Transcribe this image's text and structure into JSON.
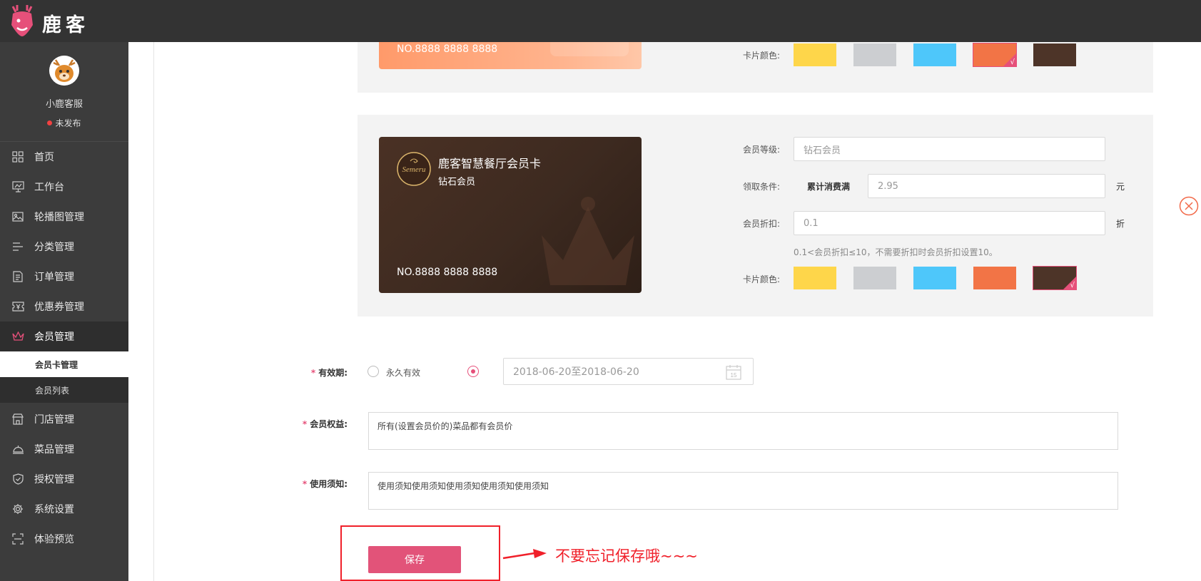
{
  "header": {
    "brand": "鹿客"
  },
  "profile": {
    "name": "小鹿客服",
    "status": "未发布"
  },
  "nav": {
    "items": [
      {
        "label": "首页",
        "icon": "grid-icon"
      },
      {
        "label": "工作台",
        "icon": "monitor-icon"
      },
      {
        "label": "轮播图管理",
        "icon": "image-icon"
      },
      {
        "label": "分类管理",
        "icon": "list-icon"
      },
      {
        "label": "订单管理",
        "icon": "document-icon"
      },
      {
        "label": "优惠券管理",
        "icon": "coupon-icon"
      },
      {
        "label": "会员管理",
        "icon": "crown-icon"
      },
      {
        "label": "门店管理",
        "icon": "store-icon"
      },
      {
        "label": "菜品管理",
        "icon": "cloche-icon"
      },
      {
        "label": "授权管理",
        "icon": "shield-icon"
      },
      {
        "label": "系统设置",
        "icon": "gear-icon"
      },
      {
        "label": "体验预览",
        "icon": "scan-icon"
      }
    ],
    "sub_items": [
      {
        "label": "会员卡管理"
      },
      {
        "label": "会员列表"
      }
    ],
    "active": "会员管理",
    "active_sub": "会员卡管理"
  },
  "card_top": {
    "number": "NO.8888 8888 8888",
    "color_label": "卡片颜色:",
    "colors": [
      "#fed64a",
      "#ccced1",
      "#4ec7fa",
      "#f27446",
      "#4d3428"
    ],
    "selected_color": "#f27446"
  },
  "card_diamond": {
    "shop_name": "鹿客智慧餐厅会员卡",
    "level_name": "钻石会员",
    "logo_text": "Semeru",
    "number": "NO.8888 8888 8888",
    "fields": {
      "level_label": "会员等级:",
      "level_value": "钻石会员",
      "condition_label": "领取条件:",
      "condition_prefix": "累计消费满",
      "condition_value": "2.95",
      "condition_unit": "元",
      "discount_label": "会员折扣:",
      "discount_value": "0.1",
      "discount_unit": "折",
      "discount_hint": "0.1<会员折扣≤10，不需要折扣时会员折扣设置10。",
      "color_label": "卡片颜色:"
    },
    "colors": [
      "#fed64a",
      "#ccced1",
      "#4ec7fa",
      "#f27446",
      "#4d3428"
    ],
    "selected_color": "#4d3428"
  },
  "form": {
    "validity_label": "有效期:",
    "forever_label": "永久有效",
    "date_range": "2018-06-20至2018-06-20",
    "calendar_day": "15",
    "rights_label": "会员权益:",
    "rights_value": "所有(设置会员价的)菜品都有会员价",
    "notice_label": "使用须知:",
    "notice_value": "使用须知使用须知使用须知使用须知使用须知",
    "save_label": "保存"
  },
  "annotation": {
    "text": "不要忘记保存哦~~~"
  },
  "theme": {
    "accent": "#e25379",
    "sidebar_bg": "#3c3c3c",
    "topbar_bg": "#333333",
    "annotation": "#f0202a"
  }
}
